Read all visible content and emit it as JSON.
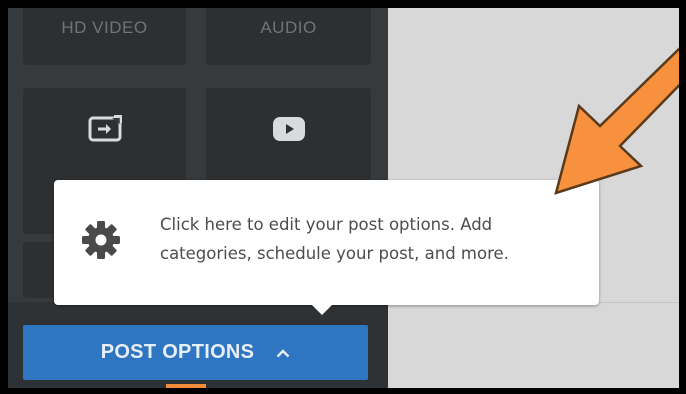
{
  "tiles": {
    "hd_video_label": "HD VIDEO",
    "audio_label": "AUDIO",
    "screen_icon": "screen-share-icon",
    "youtube_icon": "youtube-play-icon"
  },
  "tooltip": {
    "icon": "gear-icon",
    "text": "Click here to edit your post options. Add categories, schedule your post, and more."
  },
  "post_options": {
    "label": "POST OPTIONS",
    "caret_icon": "chevron-up-icon"
  },
  "colors": {
    "button_blue": "#2f76c2",
    "arrow_orange": "#f7913d",
    "panel_dark": "#373a3c"
  }
}
